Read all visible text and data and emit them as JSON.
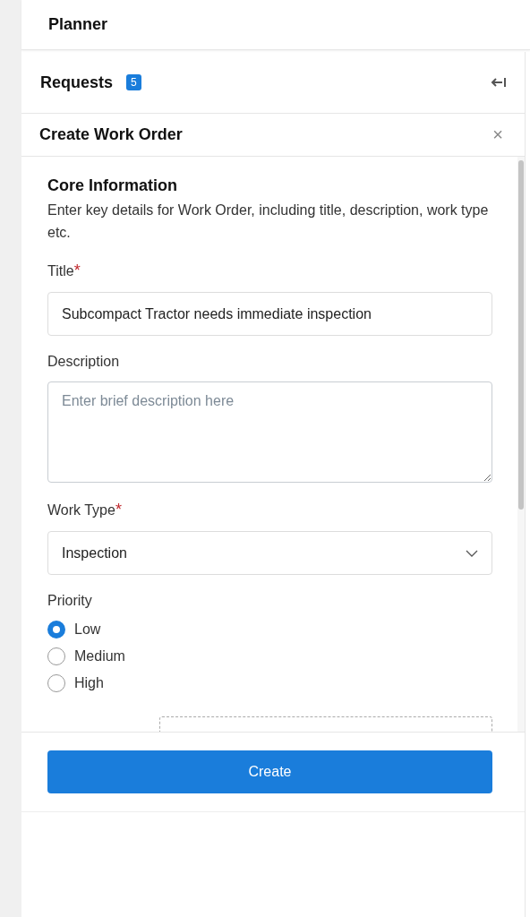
{
  "app_header": {
    "title": "Planner"
  },
  "requests_bar": {
    "title": "Requests",
    "count": "5"
  },
  "panel": {
    "title": "Create Work Order",
    "close": "×"
  },
  "section": {
    "title": "Core Information",
    "description": "Enter key details for Work Order, including title, description, work type etc."
  },
  "fields": [
    {
      "kind": "text",
      "label": "Title",
      "required_mark": "*",
      "value": "Subcompact Tractor needs immediate inspection"
    },
    {
      "kind": "textarea",
      "label": "Description",
      "placeholder": "Enter brief description here"
    },
    {
      "kind": "select",
      "label": "Work Type",
      "required_mark": "*",
      "value": "Inspection"
    }
  ],
  "priority": {
    "label": "Priority",
    "options": [
      {
        "label": "Low",
        "selected": true
      },
      {
        "label": "Medium",
        "selected": false
      },
      {
        "label": "High",
        "selected": false
      }
    ]
  },
  "footer": {
    "button": "Create"
  }
}
